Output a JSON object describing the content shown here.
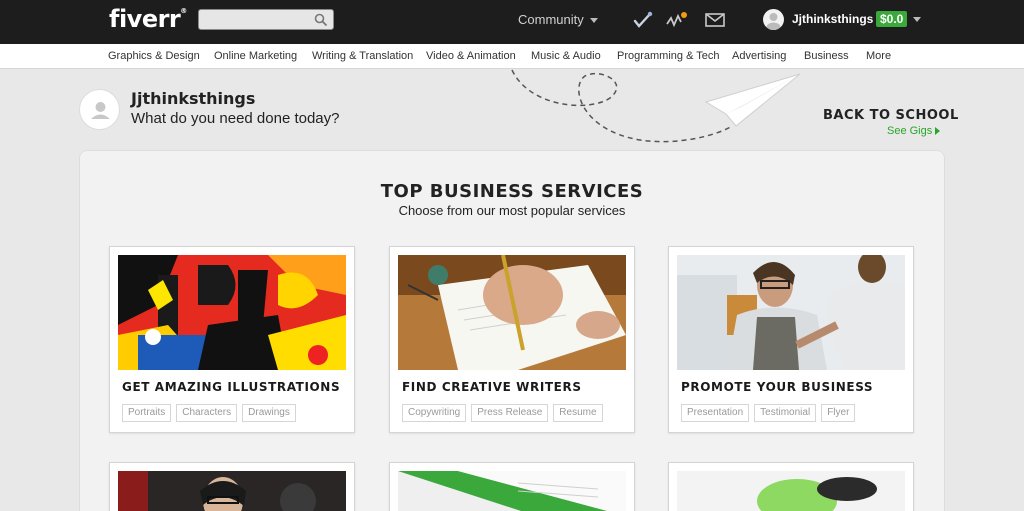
{
  "header": {
    "logo": "fiverr",
    "logo_mark": "®",
    "search_placeholder": "",
    "community_label": "Community",
    "username": "Jjthinksthings",
    "balance": "$0.0",
    "icons": [
      "search-icon",
      "feather-icon",
      "activity-icon",
      "mail-icon",
      "avatar-icon"
    ],
    "accent_color": "#3aa83a"
  },
  "categories": [
    "Graphics & Design",
    "Online Marketing",
    "Writing & Translation",
    "Video & Animation",
    "Music & Audio",
    "Programming & Tech",
    "Advertising",
    "Business",
    "More"
  ],
  "welcome": {
    "name": "Jjthinksthings",
    "question": "What do you need done today?"
  },
  "promo": {
    "title": "BACK TO SCHOOL",
    "link": "See Gigs"
  },
  "section": {
    "title": "TOP BUSINESS SERVICES",
    "subtitle": "Choose from our most popular services"
  },
  "cards": [
    {
      "title": "GET AMAZING ILLUSTRATIONS",
      "tags": [
        "Portraits",
        "Characters",
        "Drawings"
      ]
    },
    {
      "title": "FIND CREATIVE WRITERS",
      "tags": [
        "Copywriting",
        "Press Release",
        "Resume"
      ]
    },
    {
      "title": "PROMOTE YOUR BUSINESS",
      "tags": [
        "Presentation",
        "Testimonial",
        "Flyer"
      ]
    }
  ]
}
